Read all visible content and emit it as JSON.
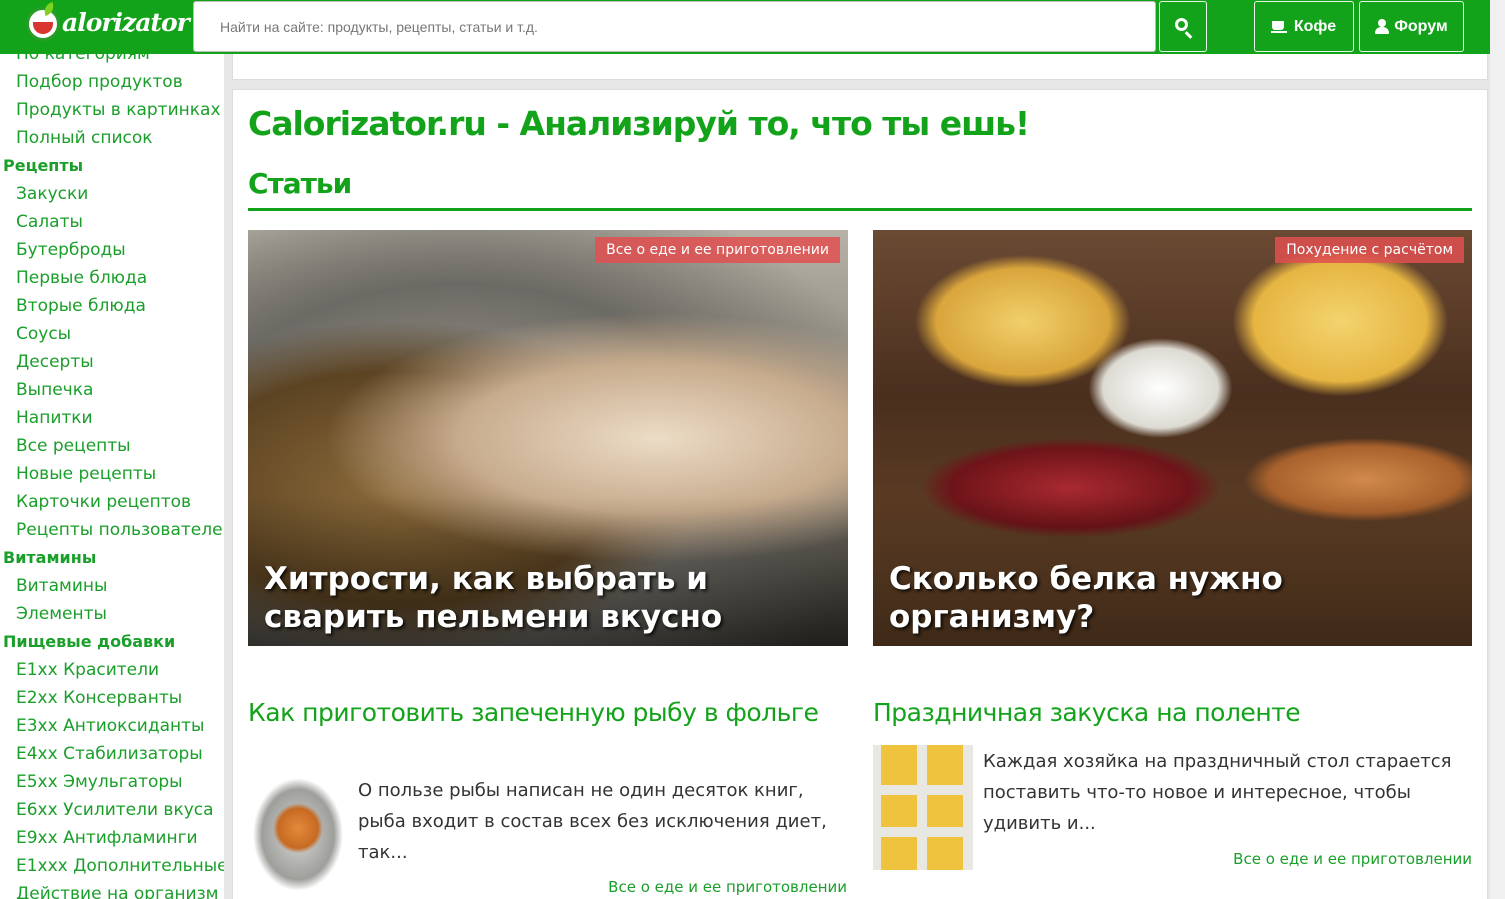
{
  "header": {
    "logo_text": "alorizator",
    "search_placeholder": "Найти на сайте: продукты, рецепты, статьи и т.д.",
    "coffee_label": "Кофе",
    "forum_label": "Форум"
  },
  "sidebar": {
    "items": [
      {
        "type": "item",
        "label": "По категориям"
      },
      {
        "type": "item",
        "label": "Подбор продуктов"
      },
      {
        "type": "item",
        "label": "Продукты в картинках"
      },
      {
        "type": "item",
        "label": "Полный список"
      },
      {
        "type": "head",
        "label": "Рецепты"
      },
      {
        "type": "item",
        "label": "Закуски"
      },
      {
        "type": "item",
        "label": "Салаты"
      },
      {
        "type": "item",
        "label": "Бутерброды"
      },
      {
        "type": "item",
        "label": "Первые блюда"
      },
      {
        "type": "item",
        "label": "Вторые блюда"
      },
      {
        "type": "item",
        "label": "Соусы"
      },
      {
        "type": "item",
        "label": "Десерты"
      },
      {
        "type": "item",
        "label": "Выпечка"
      },
      {
        "type": "item",
        "label": "Напитки"
      },
      {
        "type": "item",
        "label": "Все рецепты"
      },
      {
        "type": "item",
        "label": "Новые рецепты"
      },
      {
        "type": "item",
        "label": "Карточки рецептов"
      },
      {
        "type": "item",
        "label": "Рецепты пользователей"
      },
      {
        "type": "head",
        "label": "Витамины"
      },
      {
        "type": "item",
        "label": "Витамины"
      },
      {
        "type": "item",
        "label": "Элементы"
      },
      {
        "type": "head",
        "label": "Пищевые добавки"
      },
      {
        "type": "item",
        "label": "E1xx Красители"
      },
      {
        "type": "item",
        "label": "E2xx Консерванты"
      },
      {
        "type": "item",
        "label": "E3xx Антиоксиданты"
      },
      {
        "type": "item",
        "label": "E4xx Стабилизаторы"
      },
      {
        "type": "item",
        "label": "E5xx Эмульгаторы"
      },
      {
        "type": "item",
        "label": "E6xx Усилители вкуса"
      },
      {
        "type": "item",
        "label": "E9xx Антифламинги"
      },
      {
        "type": "item",
        "label": "E1xxx Дополнительные"
      },
      {
        "type": "item",
        "label": "Действие на организм"
      }
    ]
  },
  "main": {
    "page_title": "Calorizator.ru - Анализируй то, что ты ешь!",
    "section_title": "Статьи",
    "features": [
      {
        "badge": "Все о еде и ее приготовлении",
        "title": "Хитрости, как выбрать и сварить пельмени вкусно"
      },
      {
        "badge": "Похудение с расчётом",
        "title": "Сколько белка нужно организму?"
      }
    ],
    "articles": [
      {
        "title": "Как приготовить запеченную рыбу в фольге",
        "text": "О пользе рыбы написан не один десяток книг, рыба входит в состав всех без исключения диет, так...",
        "category": "Все о еде и ее приготовлении"
      },
      {
        "title": "Праздничная закуска на поленте",
        "text": "Каждая хозяйка на праздничный стол старается поставить что-то новое и интересное, чтобы удивить и...",
        "category": "Все о еде и ее приготовлении"
      }
    ]
  },
  "colors": {
    "brand_green": "#13a31a",
    "badge_red": "#e05050"
  }
}
